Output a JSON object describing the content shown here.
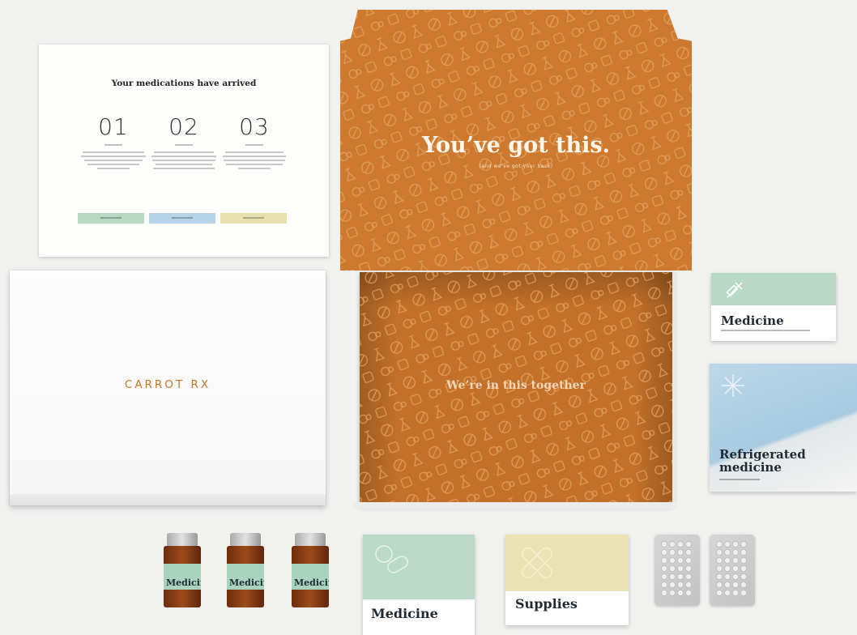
{
  "insert_card": {
    "title": "Your medications have arrived",
    "steps": [
      {
        "number": "01"
      },
      {
        "number": "02"
      },
      {
        "number": "03"
      }
    ],
    "pill_colors": [
      "#b9d9c4",
      "#b7d3e7",
      "#e6e0ae"
    ]
  },
  "white_box": {
    "brand": "CARROT RX",
    "brand_color": "#c4782a"
  },
  "orange_box": {
    "lid_text": "You’ve got this.",
    "lid_subtext": "(and we've got your back)",
    "inside_text": "We’re in this together",
    "color": "#cd7a30"
  },
  "packages": {
    "medicine_box_right": "Medicine",
    "refrigerated_bag": "Refrigerated medicine",
    "bottle_labels": [
      "Medicine",
      "Medicine",
      "Medicine"
    ],
    "medicine_box_bottom": "Medicine",
    "supplies_box": "Supplies"
  },
  "icons": [
    "pill-icon",
    "flask-icon",
    "syringe-icon",
    "bandage-icon",
    "snowflake-icon",
    "blister-pack-icon"
  ]
}
